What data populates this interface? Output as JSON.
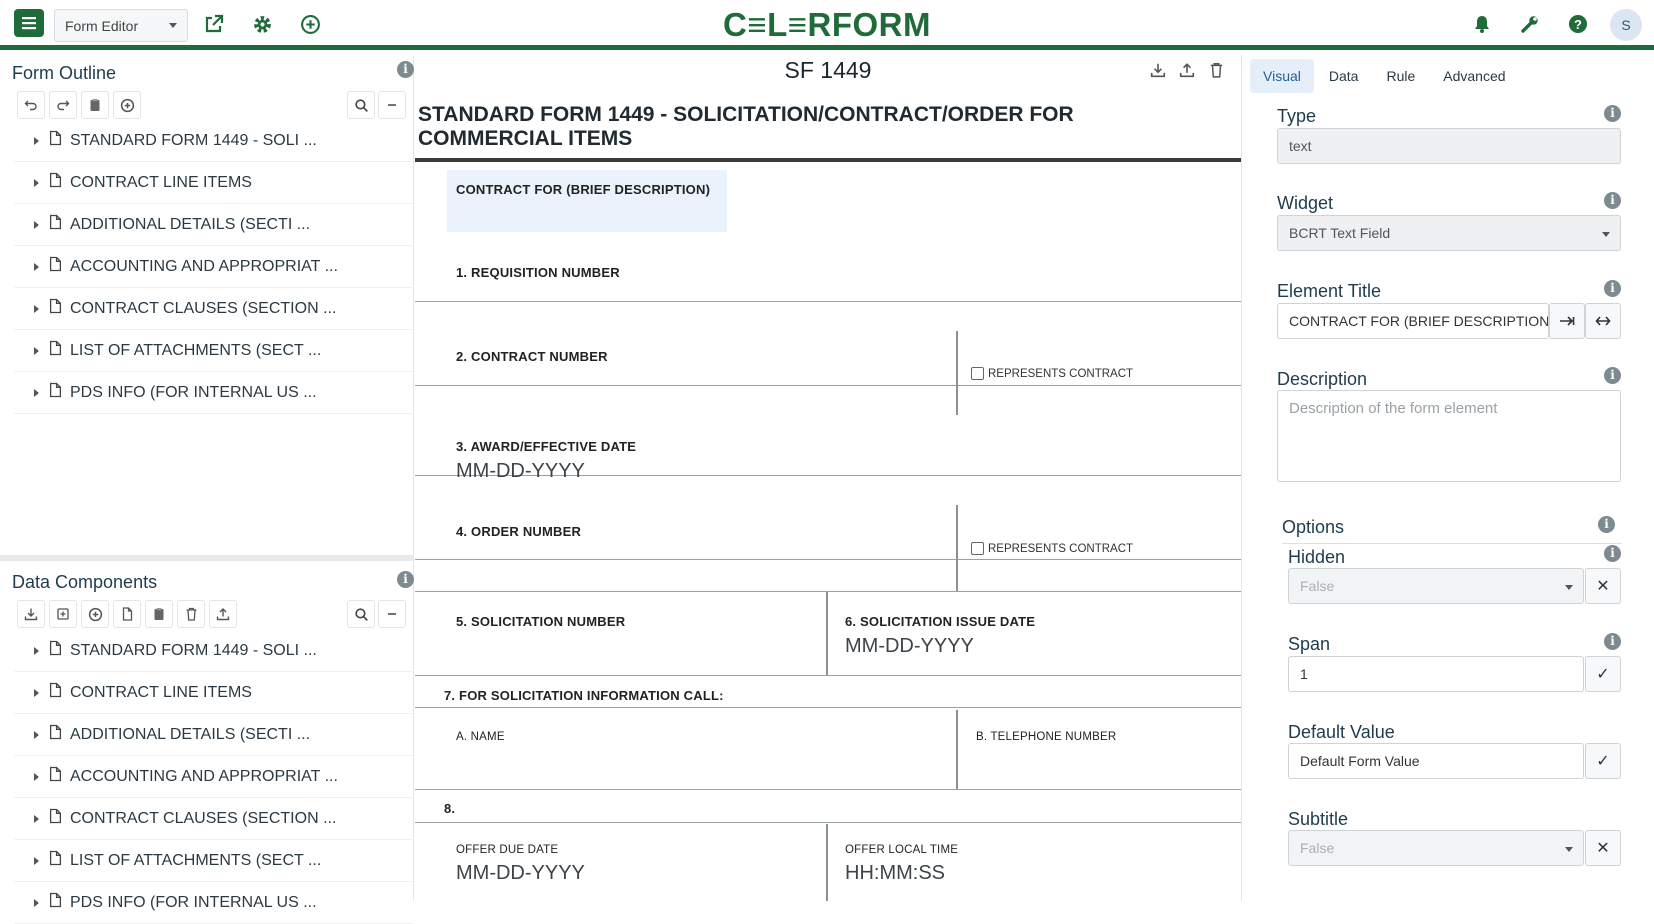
{
  "topbar": {
    "mode": "Form Editor",
    "logo": "C≡L≡RFORM",
    "avatar": "S"
  },
  "outline": {
    "title": "Form Outline",
    "items": [
      "STANDARD FORM 1449 - SOLI ...",
      "CONTRACT LINE ITEMS",
      "ADDITIONAL DETAILS (SECTI ...",
      "ACCOUNTING AND APPROPRIAT ...",
      "CONTRACT CLAUSES (SECTION ...",
      "LIST OF ATTACHMENTS (SECT ...",
      "PDS INFO (FOR INTERNAL US ..."
    ]
  },
  "components": {
    "title": "Data Components",
    "items": [
      "STANDARD FORM 1449 - SOLI ...",
      "CONTRACT LINE ITEMS",
      "ADDITIONAL DETAILS (SECTI ...",
      "ACCOUNTING AND APPROPRIAT ...",
      "CONTRACT CLAUSES (SECTION ...",
      "LIST OF ATTACHMENTS (SECT ...",
      "PDS INFO (FOR INTERNAL US ..."
    ]
  },
  "form": {
    "name": "SF 1449",
    "heading": "STANDARD FORM 1449 - SOLICITATION/CONTRACT/ORDER FOR COMMERCIAL ITEMS",
    "contract_for": "CONTRACT FOR (BRIEF DESCRIPTION)",
    "req_number": "1. REQUISITION NUMBER",
    "contract_number": "2. CONTRACT NUMBER",
    "represents_contract": "REPRESENTS CONTRACT",
    "award_date": "3. AWARD/EFFECTIVE DATE",
    "date_placeholder": "MM-DD-YYYY",
    "order_number": "4. ORDER NUMBER",
    "solicitation_number": "5. SOLICITATION NUMBER",
    "solicitation_issue_date": "6. SOLICITATION ISSUE DATE",
    "info_call": "7. FOR SOLICITATION INFORMATION CALL:",
    "a_name": "A. NAME",
    "b_phone": "B. TELEPHONE NUMBER",
    "eight": "8.",
    "offer_due_date": "OFFER DUE DATE",
    "offer_local_time": "OFFER LOCAL TIME",
    "time_placeholder": "HH:MM:SS"
  },
  "props": {
    "tabs": [
      "Visual",
      "Data",
      "Rule",
      "Advanced"
    ],
    "type_label": "Type",
    "type_value": "text",
    "widget_label": "Widget",
    "widget_value": "BCRT Text Field",
    "title_label": "Element Title",
    "title_value": "CONTRACT FOR (BRIEF DESCRIPTION",
    "desc_label": "Description",
    "desc_placeholder": "Description of the form element",
    "options_label": "Options",
    "hidden_label": "Hidden",
    "hidden_value": "False",
    "span_label": "Span",
    "span_value": "1",
    "default_label": "Default Value",
    "default_value": "Default Form Value",
    "subtitle_label": "Subtitle",
    "subtitle_value": "False"
  },
  "colors": {
    "brand": "#1f6b3a",
    "tab_active": "#1f5f9c"
  }
}
